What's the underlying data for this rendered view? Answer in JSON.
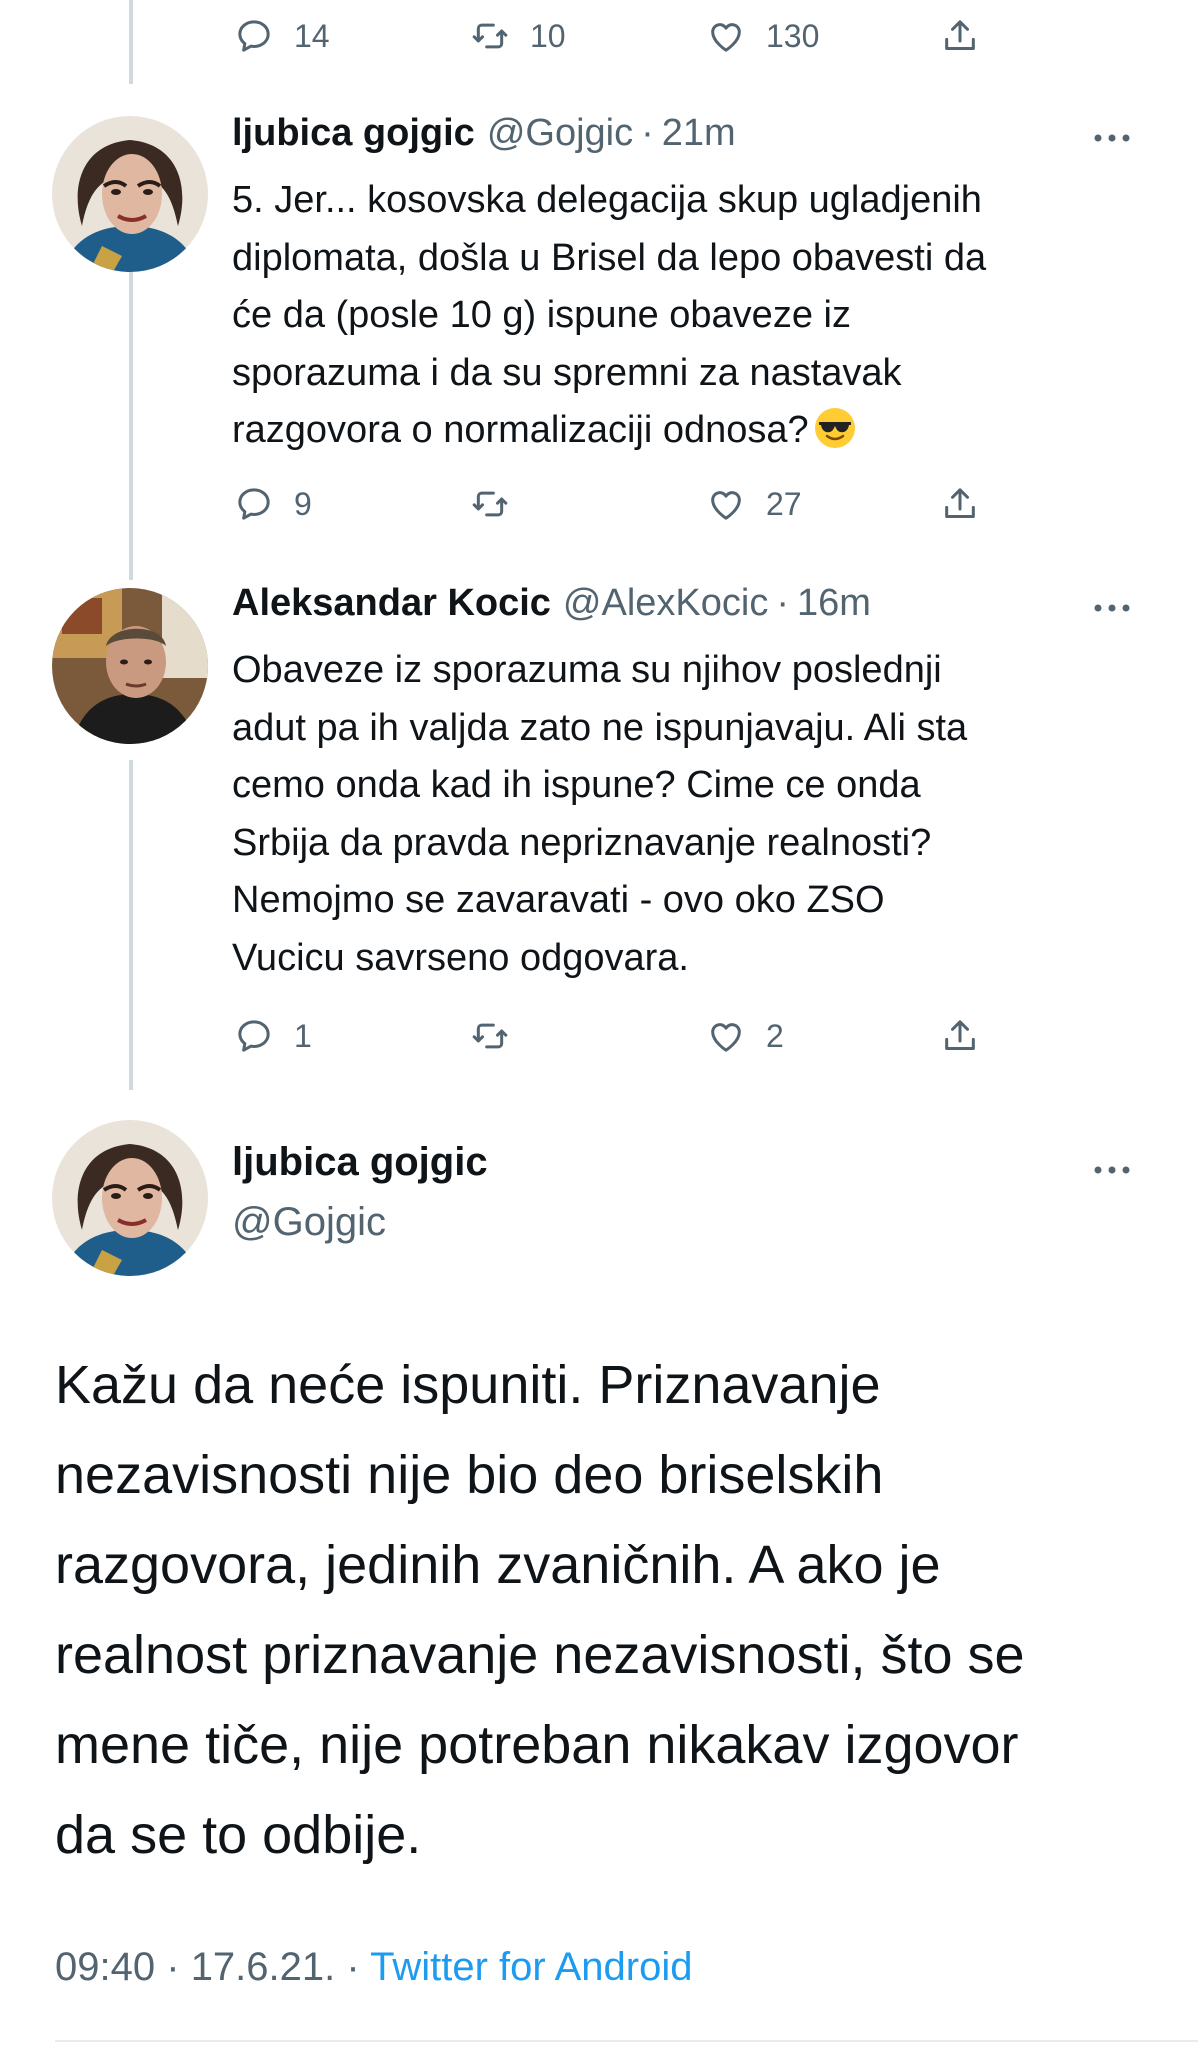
{
  "top_tweet_actions": {
    "replies": "14",
    "retweets": "10",
    "likes": "130"
  },
  "tweets": [
    {
      "name": "ljubica gojgic",
      "handle": "@Gojgic",
      "separator": "·",
      "time": "21m",
      "text_lines": [
        "5. Jer... kosovska delegacija skup ugladjenih",
        "diplomata, došla u Brisel da lepo obavesti da",
        "će da (posle 10 g) ispune obaveze iz",
        "sporazuma i da su spremni za nastavak",
        "razgovora o normalizaciji odnosa?"
      ],
      "emoji": "smiling-face-with-sunglasses",
      "replies": "9",
      "retweets": "",
      "likes": "27"
    },
    {
      "name": "Aleksandar Kocic",
      "handle": "@AlexKocic",
      "separator": "·",
      "time": "16m",
      "text_lines": [
        "Obaveze iz sporazuma su njihov poslednji",
        "adut pa ih valjda zato ne ispunjavaju. Ali sta",
        "cemo onda kad ih ispune? Cime ce onda",
        "Srbija da pravda nepriznavanje realnosti?",
        "Nemojmo se zavaravati - ovo oko ZSO",
        "Vucicu savrseno odgovara."
      ],
      "replies": "1",
      "retweets": "",
      "likes": "2"
    }
  ],
  "focus_tweet": {
    "name": "ljubica gojgic",
    "handle": "@Gojgic",
    "text_lines": [
      "Kažu da neće ispuniti. Priznavanje",
      "nezavisnosti nije bio deo briselskih",
      "razgovora, jedinih zvaničnih. A ako je",
      "realnost priznavanje nezavisnosti, što se",
      "mene tiče, nije potreban nikakav izgovor",
      "da se to odbije."
    ],
    "time": "09:40",
    "date": "17.6.21.",
    "separator": "·",
    "source": "Twitter for Android"
  },
  "colors": {
    "text": "#0f1419",
    "secondary": "#536471",
    "link": "#1d9bf0",
    "thread_line": "#cfd9de"
  }
}
